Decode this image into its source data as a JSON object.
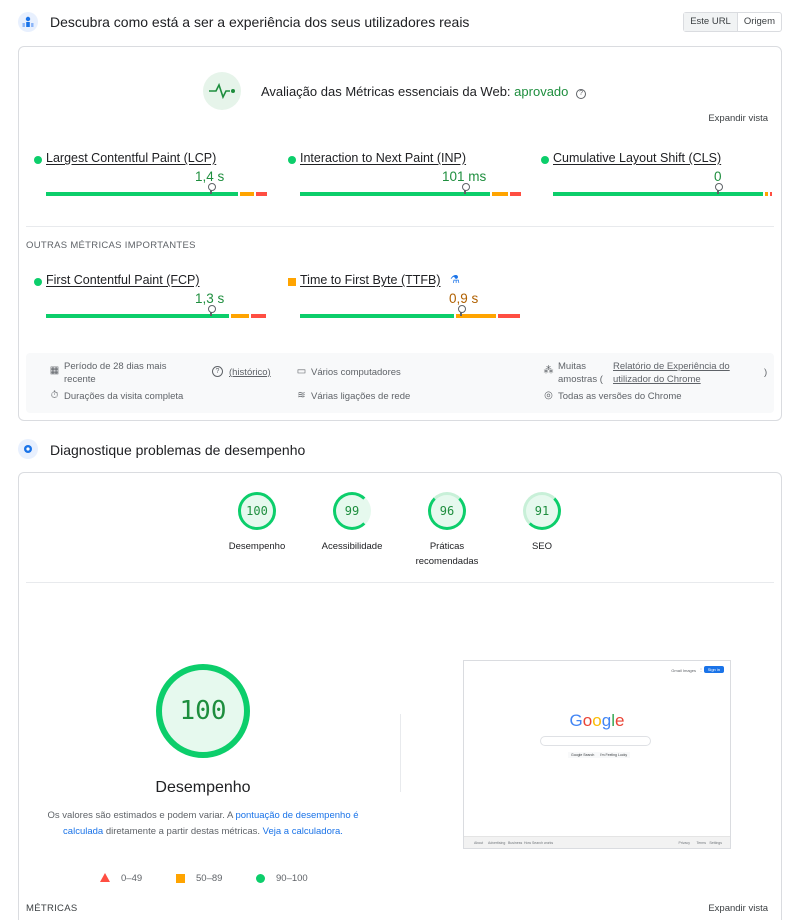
{
  "crux": {
    "title": "Descubra como está a ser a experiência dos seus utilizadores reais",
    "tabs": [
      "Este URL",
      "Origem"
    ],
    "assessment_prefix": "Avaliação das Métricas essenciais da Web:",
    "assessment_status": "aprovado",
    "expand_label": "Expandir vista",
    "core_metrics": [
      {
        "name": "Largest Contentful Paint (LCP)",
        "value": "1,4 s",
        "status": "good"
      },
      {
        "name": "Interaction to Next Paint (INP)",
        "value": "101 ms",
        "status": "good"
      },
      {
        "name": "Cumulative Layout Shift (CLS)",
        "value": "0",
        "status": "good"
      }
    ],
    "other_heading": "OUTRAS MÉTRICAS IMPORTANTES",
    "other_metrics": [
      {
        "name": "First Contentful Paint (FCP)",
        "value": "1,3 s",
        "status": "good"
      },
      {
        "name": "Time to First Byte (TTFB)",
        "value": "0,9 s",
        "status": "average"
      }
    ],
    "info": {
      "period": "Período de 28 dias mais recente",
      "history_link": "(histórico)",
      "duration": "Durações da visita completa",
      "devices": "Vários computadores",
      "network": "Várias ligações de rede",
      "samples_prefix": "Muitas amostras (",
      "samples_link": "Relatório de Experiência do utilizador do Chrome",
      "samples_suffix": ")",
      "chrome": "Todas as versões do Chrome"
    }
  },
  "diag": {
    "title": "Diagnostique problemas de desempenho",
    "scores": [
      {
        "value": "100",
        "label": "Desempenho"
      },
      {
        "value": "99",
        "label": "Acessibilidade"
      },
      {
        "value": "96",
        "label": "Práticas recomendadas"
      },
      {
        "value": "91",
        "label": "SEO"
      }
    ],
    "big_score": "100",
    "big_label": "Desempenho",
    "note_text1": "Os valores são estimados e podem variar. A",
    "note_link1": "pontuação de desempenho é calculada",
    "note_text2": "diretamente a partir destas métricas.",
    "note_link2": "Veja a calculadora.",
    "legend": [
      "0–49",
      "50–89",
      "90–100"
    ],
    "metrics_heading": "MÉTRICAS",
    "expand_label": "Expandir vista",
    "screenshot": {
      "brand": "Google",
      "top_links": [
        "Gmail",
        "Images"
      ],
      "signin": "Sign in",
      "btn1": "Google Search",
      "btn2": "I'm Feeling Lucky",
      "footer_left": [
        "About",
        "Advertising",
        "Business",
        "How Search works"
      ],
      "footer_right": [
        "Privacy",
        "Terms",
        "Settings"
      ]
    }
  }
}
